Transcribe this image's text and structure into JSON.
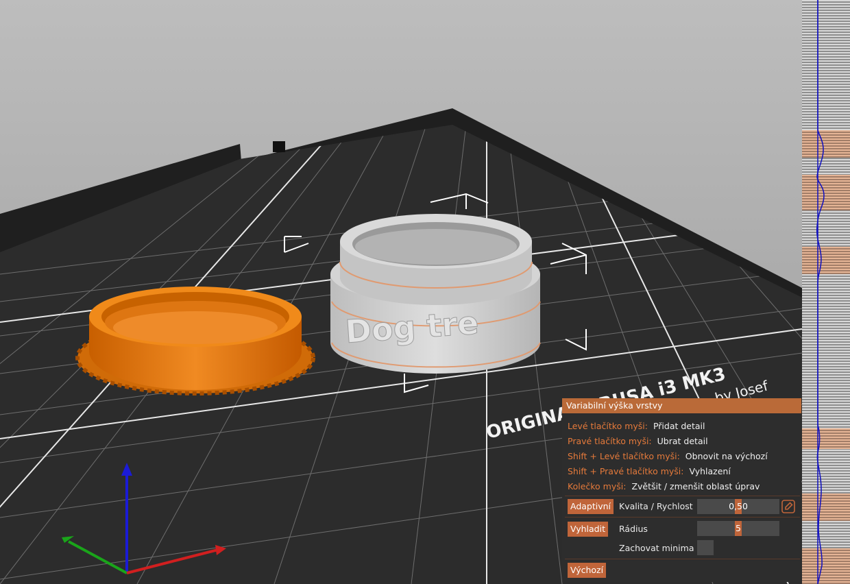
{
  "viewport": {
    "bed_text": "ORIGINAL PRUSA i3 MK3",
    "bed_subtext": "by Josef",
    "model_text": "Dog tre",
    "colors": {
      "selected": "#e2760f",
      "model": "#c9c9c9",
      "bed": "#2b2b2b",
      "axis_x": "#d11f1f",
      "axis_y": "#1aa51a",
      "axis_z": "#1b1bd6"
    }
  },
  "panel": {
    "title": "Variabilní výška vrstvy",
    "hints": [
      {
        "key": "Levé tlačítko myši:",
        "desc": "Přidat detail"
      },
      {
        "key": "Pravé tlačítko myši:",
        "desc": "Ubrat detail"
      },
      {
        "key": "Shift + Levé tlačítko myši:",
        "desc": "Obnovit na výchozí"
      },
      {
        "key": "Shift + Pravé tlačítko myši:",
        "desc": "Vyhlazení"
      },
      {
        "key": "Kolečko myši:",
        "desc": "Zvětšit / zmenšit oblast úprav"
      }
    ],
    "adaptive": {
      "button": "Adaptivní",
      "label": "Kvalita / Rychlost",
      "value": "0,50",
      "fraction": 0.5,
      "edit_icon": "pencil-icon"
    },
    "smooth": {
      "button": "Vyhladit",
      "radius_label": "Rádius",
      "radius_value": "5",
      "radius_fraction": 0.5,
      "keep_min_label": "Zachovat minima",
      "keep_min_checked": false
    },
    "reset": {
      "button": "Výchozí"
    },
    "colors": {
      "accent": "#c0653a",
      "bg": "#2d2d2d",
      "title_bg": "#ba6a38",
      "key_text": "#e57a3b"
    }
  },
  "layer_profile": {
    "line_color": "#1010c0"
  }
}
